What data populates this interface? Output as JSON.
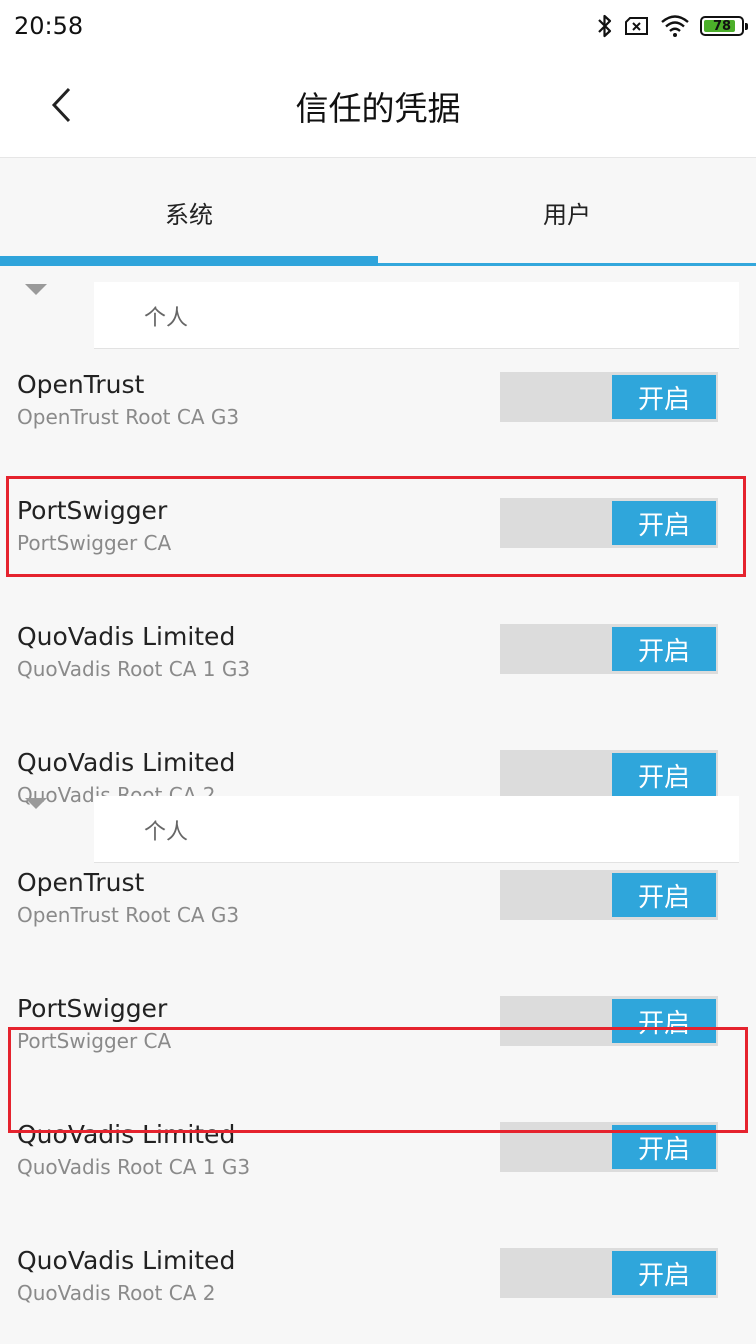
{
  "status_bar": {
    "time": "20:58",
    "icons": [
      "bluetooth-icon",
      "sim-blocked-icon",
      "wifi-icon"
    ],
    "battery": "78"
  },
  "header": {
    "title": "信任的凭据"
  },
  "tabs": [
    {
      "label": "系统",
      "active": true
    },
    {
      "label": "用户",
      "active": false
    }
  ],
  "sections": [
    {
      "label": "个人",
      "items": [
        {
          "title": "OpenTrust",
          "subtitle": "OpenTrust Root CA G3",
          "toggle": "开启"
        },
        {
          "title": "PortSwigger",
          "subtitle": "PortSwigger CA",
          "toggle": "开启",
          "highlighted": true
        },
        {
          "title": "QuoVadis Limited",
          "subtitle": "QuoVadis Root CA 1 G3",
          "toggle": "开启"
        },
        {
          "title": "QuoVadis Limited",
          "subtitle": "QuoVadis Root CA 2",
          "toggle": "开启"
        }
      ]
    },
    {
      "label": "个人",
      "items": [
        {
          "title": "OpenTrust",
          "subtitle": "OpenTrust Root CA G3",
          "toggle": "开启"
        },
        {
          "title": "PortSwigger",
          "subtitle": "PortSwigger CA",
          "toggle": "开启",
          "highlighted": true
        },
        {
          "title": "QuoVadis Limited",
          "subtitle": "QuoVadis Root CA 1 G3",
          "toggle": "开启"
        },
        {
          "title": "QuoVadis Limited",
          "subtitle": "QuoVadis Root CA 2",
          "toggle": "开启"
        }
      ]
    }
  ],
  "colors": {
    "accent": "#2fa6db",
    "highlight": "#e5232e"
  }
}
